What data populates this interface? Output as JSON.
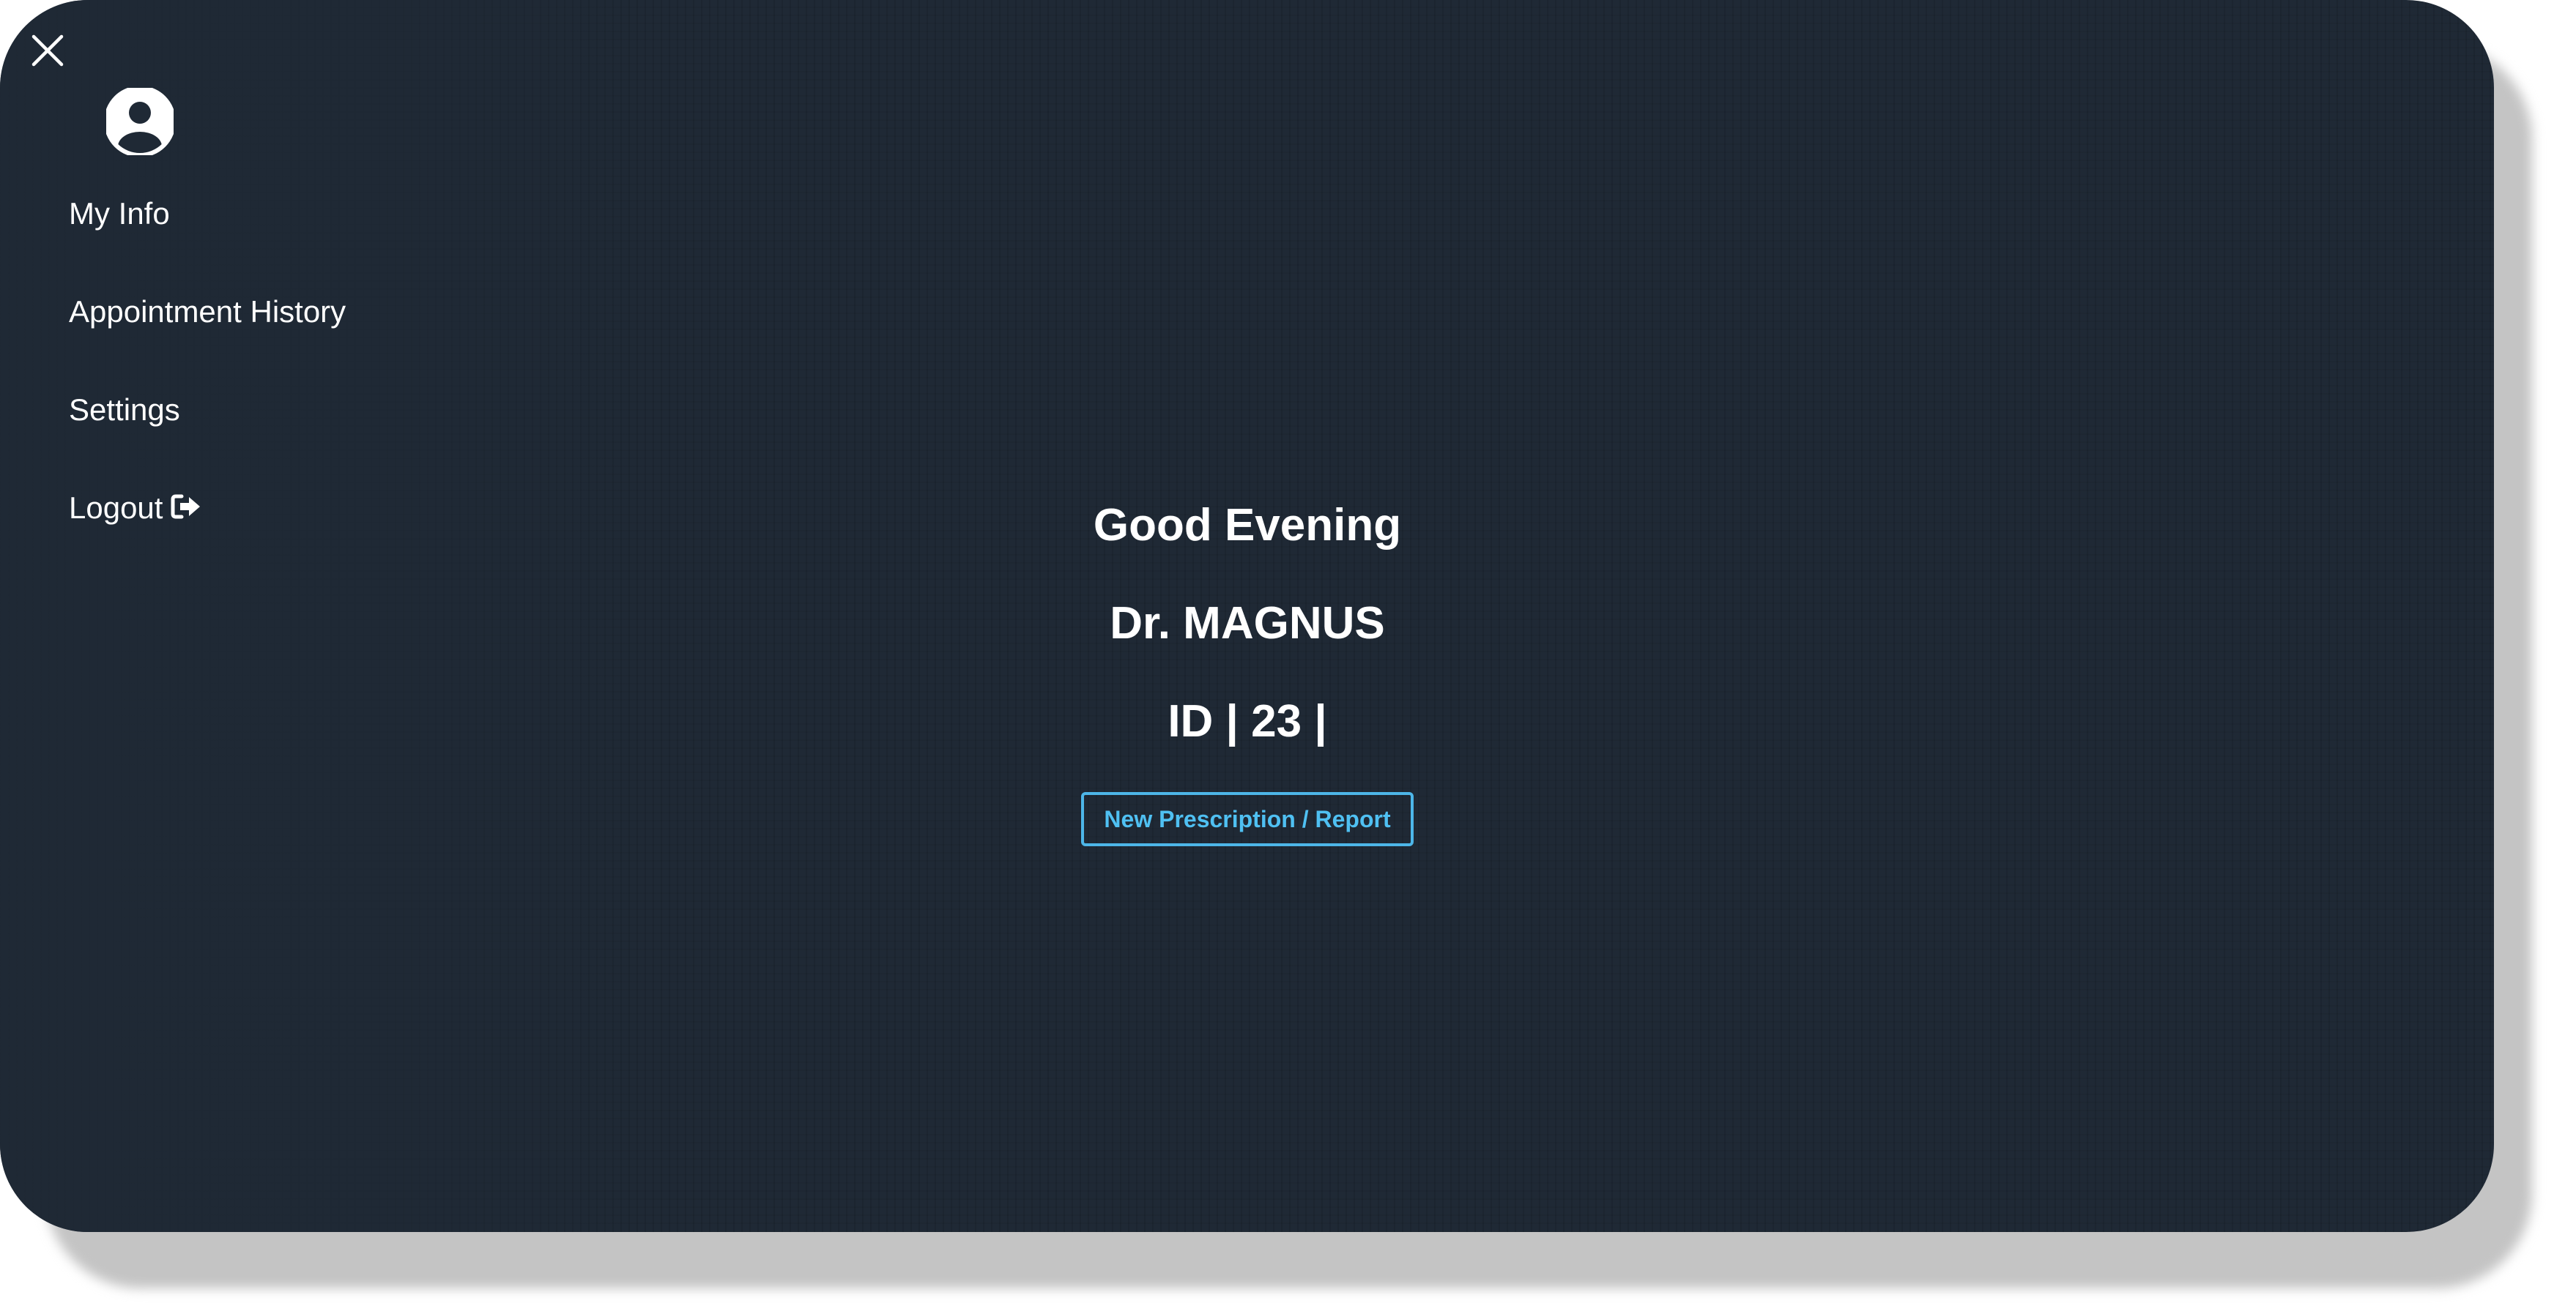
{
  "menu": {
    "close_icon": "close-icon",
    "avatar_icon": "user-circle-icon",
    "items": [
      {
        "label": "My Info"
      },
      {
        "label": "Appointment History"
      },
      {
        "label": "Settings"
      },
      {
        "label": "Logout",
        "icon": "sign-out-icon"
      }
    ]
  },
  "main": {
    "greeting": "Good Evening",
    "doctor_name": "Dr. MAGNUS",
    "doctor_id": "ID | 23 |",
    "new_button_label": "New Prescription / Report"
  },
  "colors": {
    "background": "#1f2935",
    "text": "#ffffff",
    "accent": "#4fc0f2"
  }
}
